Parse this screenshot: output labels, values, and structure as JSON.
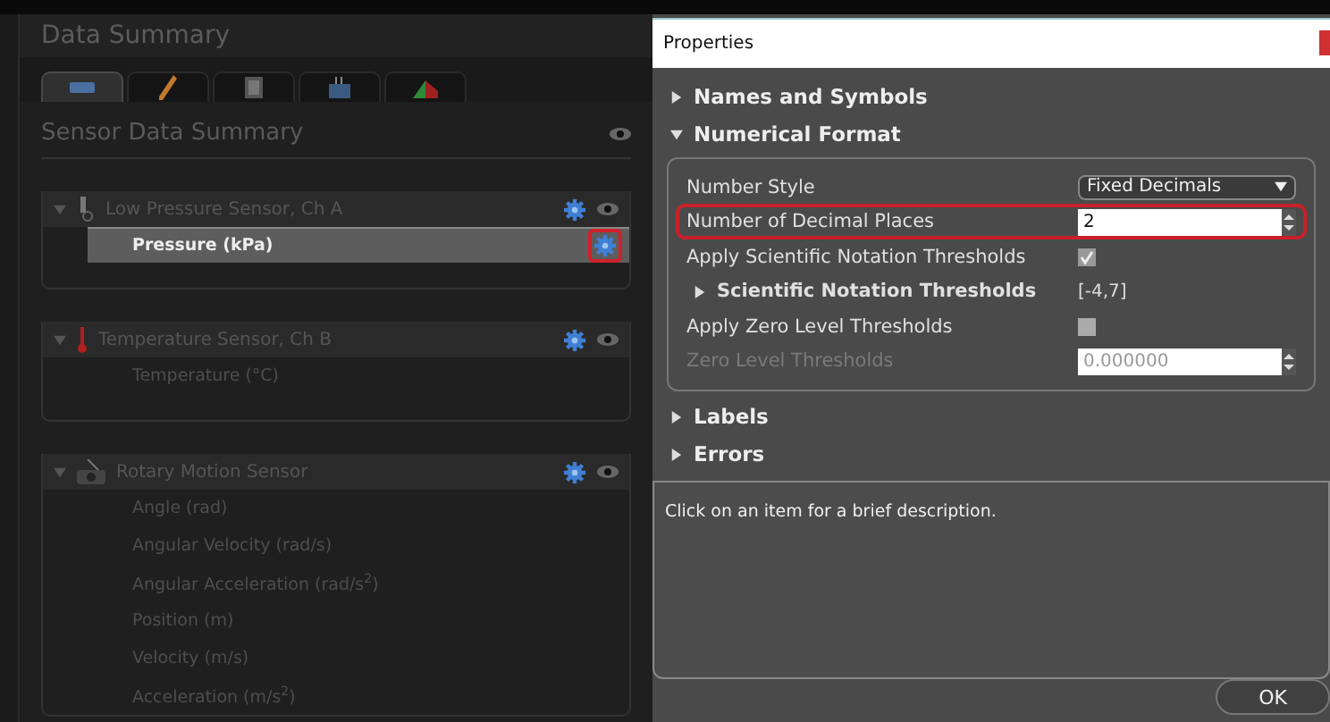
{
  "panel": {
    "title": "Data Summary",
    "tabs": [
      {
        "kind": "sensor",
        "selected": true
      },
      {
        "kind": "pencil",
        "selected": false
      },
      {
        "kind": "calculator",
        "selected": false
      },
      {
        "kind": "device",
        "selected": false
      },
      {
        "kind": "graph",
        "selected": false
      }
    ],
    "heading": "Sensor Data Summary",
    "groups": [
      {
        "name": "Low Pressure Sensor, Ch A",
        "kind": "probe",
        "expanded": true,
        "rows": [
          {
            "label": "Pressure (kPa)",
            "selected": true,
            "highlighted": true
          }
        ]
      },
      {
        "name": "Temperature Sensor, Ch B",
        "kind": "thermometer",
        "expanded": true,
        "rows": [
          {
            "label": "Temperature (°C)",
            "selected": false
          }
        ]
      },
      {
        "name": "Rotary Motion Sensor",
        "kind": "rotary",
        "expanded": true,
        "rows": [
          {
            "label": "Angle (rad)",
            "selected": false
          },
          {
            "label": "Angular Velocity (rad/s)",
            "selected": false
          },
          {
            "label": "Angular Acceleration (rad/s$^{2}$)",
            "selected": false
          },
          {
            "label": "Position (m)",
            "selected": false
          },
          {
            "label": "Velocity (m/s)",
            "selected": false
          },
          {
            "label": "Acceleration (m/s$^{2}$)",
            "selected": false
          }
        ]
      }
    ]
  },
  "dialog": {
    "title": "Properties",
    "sections": [
      {
        "label": "Names and Symbols",
        "expanded": false
      },
      {
        "label": "Numerical Format",
        "expanded": true,
        "properties": [
          {
            "kind": "dropdown",
            "label": "Number Style",
            "value": "Fixed Decimals",
            "disabled": false,
            "highlighted": false
          },
          {
            "kind": "spinner",
            "label": "Number of Decimal Places",
            "value": "2",
            "disabled": false,
            "highlighted": true
          },
          {
            "kind": "checkbox",
            "label": "Apply Scientific Notation Thresholds",
            "checked": true,
            "disabled": false,
            "highlighted": false
          },
          {
            "kind": "expander",
            "label": "Scientific Notation Thresholds",
            "value": "[-4,7]",
            "expanded": false,
            "disabled": false,
            "highlighted": false
          },
          {
            "kind": "checkbox",
            "label": "Apply Zero Level Thresholds",
            "checked": false,
            "disabled": false,
            "highlighted": false
          },
          {
            "kind": "spinner",
            "label": "Zero Level Thresholds",
            "value": "0.000000",
            "disabled": true,
            "highlighted": false
          }
        ]
      },
      {
        "label": "Labels",
        "expanded": false
      },
      {
        "label": "Errors",
        "expanded": false
      }
    ],
    "description": "Click on an item for a brief description.",
    "button": "OK"
  }
}
